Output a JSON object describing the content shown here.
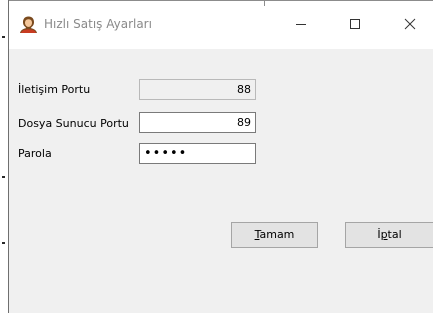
{
  "window": {
    "title": "Hızlı Satış Ayarları",
    "app_icon": "user-avatar-icon",
    "controls": [
      "minimize-icon",
      "maximize-icon",
      "close-icon"
    ]
  },
  "form": {
    "port_label": "İletişim Portu",
    "port_value": "88",
    "file_server_port_label": "Dosya Sunucu Portu",
    "file_server_port_value": "89",
    "password_label": "Parola",
    "password_value": "•••••"
  },
  "buttons": {
    "ok_label": "Tamam",
    "cancel_label": "İptal"
  },
  "colors": {
    "title_text": "#8a8a8a",
    "dialog_background": "#f0f0f0",
    "readonly_field": "#f0f0f0"
  }
}
